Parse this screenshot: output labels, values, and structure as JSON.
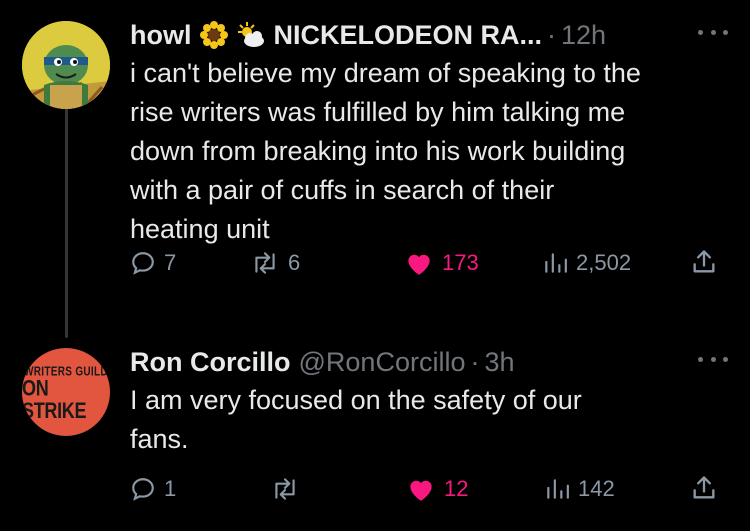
{
  "tweets": [
    {
      "display_name": "howl",
      "display_name_extra": "NICKELODEON RA...",
      "emojis": [
        "sunflower-emoji",
        "sun-behind-cloud-emoji"
      ],
      "handle": "",
      "time": "12h",
      "text": "i can't believe my dream of speaking to the\nrise writers was fulfilled by him talking me\ndown from breaking into his work building\nwith a pair of cuffs in search of their\nheating unit",
      "replies": "7",
      "retweets": "6",
      "likes": "173",
      "views": "2,502",
      "liked": true
    },
    {
      "display_name": "Ron Corcillo",
      "handle": "@RonCorcillo",
      "time": "3h",
      "avatar_text_top": "WRITERS GUILD",
      "avatar_text_bottom": "ON STRIKE",
      "text": "I am very focused on the safety of our\nfans.",
      "replies": "1",
      "retweets": "",
      "likes": "12",
      "views": "142",
      "liked": true
    }
  ],
  "dot_separator": "·",
  "colors": {
    "background": "#000000",
    "text": "#e7e9ea",
    "secondary": "#71767b",
    "like": "#f91880",
    "avatar2_bg": "#e2553f",
    "avatar1_bg": "#d9c93a"
  }
}
